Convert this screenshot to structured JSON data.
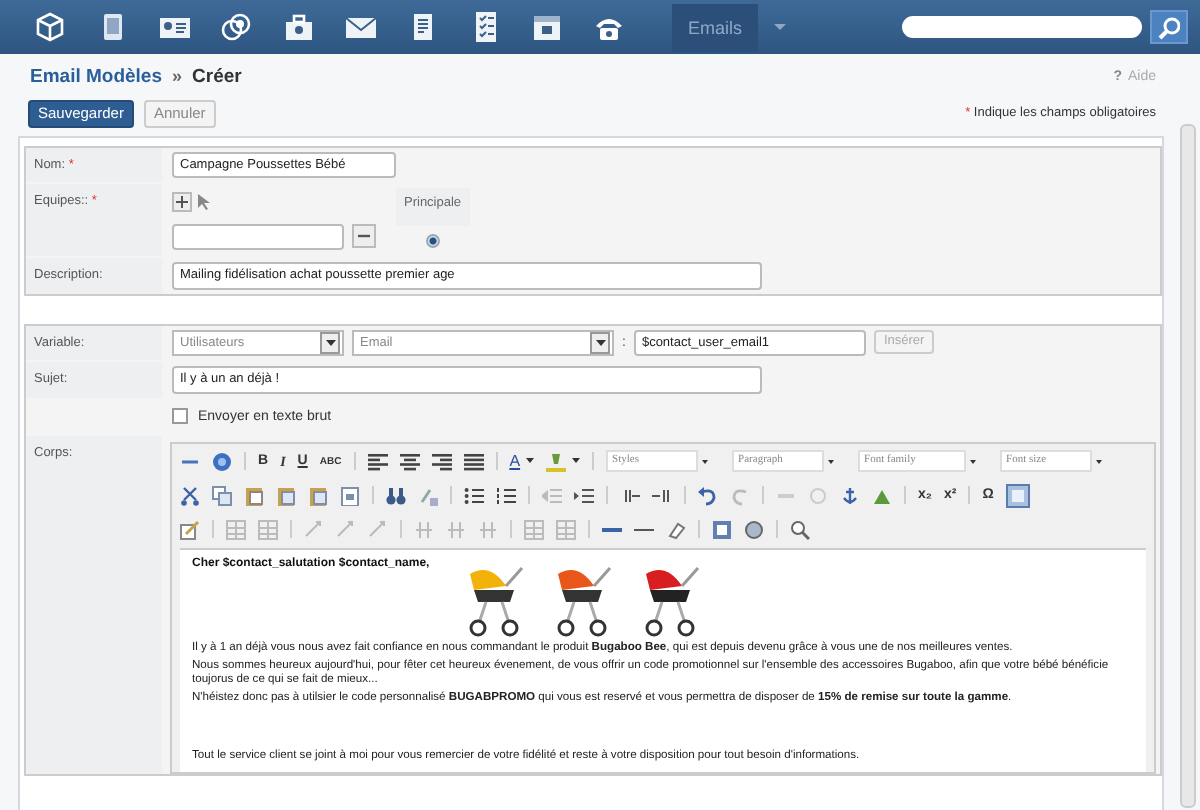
{
  "nav": {
    "tabs": [
      {
        "label": "Emails",
        "selected": true
      }
    ]
  },
  "breadcrumb": {
    "parent": "Email Modèles",
    "separator": "»",
    "current": "Créer"
  },
  "help": {
    "mark": "?",
    "label": "Aide"
  },
  "actions": [
    {
      "label": "Sauvegarder",
      "kind": "primary"
    },
    {
      "label": "Annuler",
      "kind": "secondary"
    }
  ],
  "required_note": {
    "mark": "*",
    "text": "Indique les champs obligatoires"
  },
  "form": {
    "name": {
      "label": "Nom:",
      "required_mark": "*",
      "value": "Campagne Poussettes Bébé"
    },
    "teams": {
      "label": "Equipes::",
      "required_mark": "*",
      "column": "Principale",
      "primary_selected": true
    },
    "description": {
      "label": "Description:",
      "value": "Mailing fidélisation achat poussette premier age"
    },
    "variable": {
      "label": "Variable:",
      "module": "Utilisateurs",
      "field": "Email",
      "separator": ":",
      "value": "$contact_user_email1",
      "button": "Insérer"
    },
    "subject": {
      "label": "Sujet:",
      "value": "Il y à un an déjà !"
    },
    "plain_text": {
      "label": "Envoyer en texte brut",
      "checked": false
    },
    "body": {
      "label": "Corps:"
    }
  },
  "editor": {
    "glyphs": [
      "B",
      "I",
      "U",
      "ABC",
      "A",
      "x₂",
      "x²",
      "Ω"
    ],
    "dropdowns": [
      "Styles",
      "Paragraph",
      "Font family",
      "Font size"
    ],
    "content": {
      "greeting": "Cher $contact_salutation $contact_name,",
      "paragraphs": [
        "Il y à 1 an déjà vous nous avez fait confiance en nous commandant le produit **Bugaboo Bee**, qui est depuis devenu grâce à vous une de nos meilleures ventes.",
        "Nous sommes heureux aujourd'hui, pour fêter cet heureux évenement, de vous offrir un code promotionnel sur l'ensemble des accessoires Bugaboo, afin que votre bébé bénéficie toujorus de ce qui se fait de mieux...",
        "N'héistez donc pas à utilsier le code personnalisé **BUGABPROMO** qui vous est reservé et vous permettra de disposer de **15% de remise sur toute la gamme**.",
        "Tout le service client se joint à moi pour vous remercier de votre fidélité et reste à votre disposition pour tout besoin d'informations."
      ]
    }
  }
}
